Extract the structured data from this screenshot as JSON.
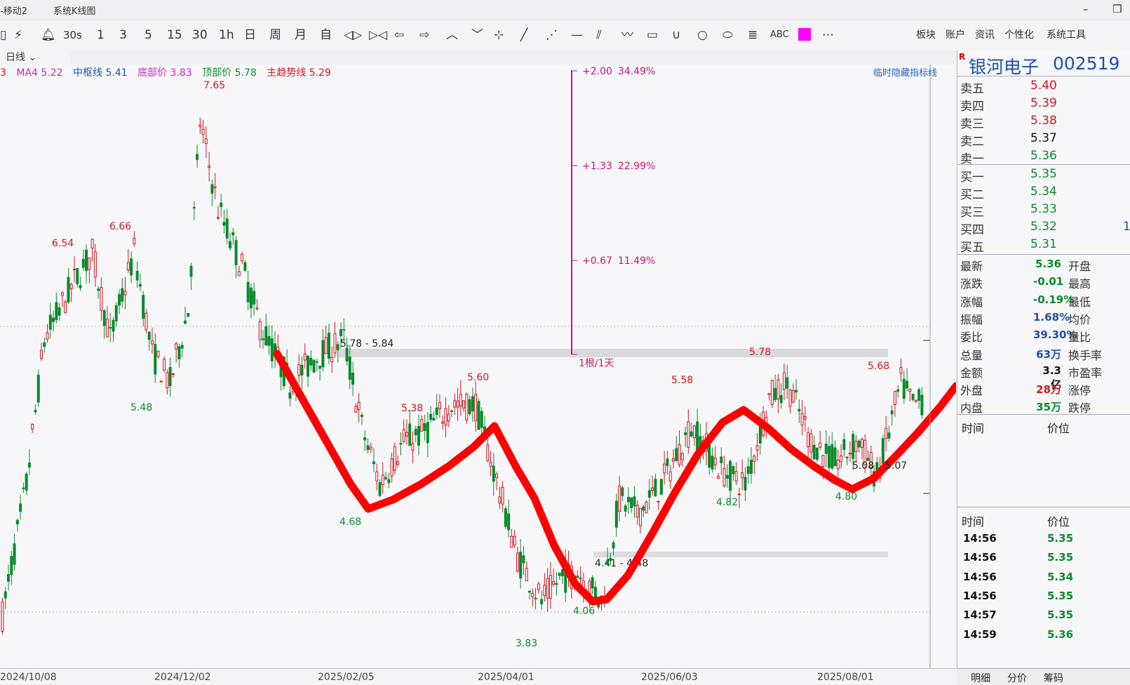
{
  "titlebar": {
    "app": "-移动2",
    "window": "系统K线图"
  },
  "toolbar": {
    "periods": [
      "30s",
      "1",
      "3",
      "5",
      "15",
      "30",
      "1h",
      "日",
      "周",
      "月",
      "自"
    ],
    "draw_tools": [
      "ABC"
    ],
    "menus": [
      "板块",
      "账户",
      "资讯",
      "个性化",
      "系统工具"
    ]
  },
  "period_select": "日线",
  "indicators": [
    {
      "text": "3",
      "color": "#d4141c"
    },
    {
      "text": "MA4 5.22",
      "color": "#cc22cc"
    },
    {
      "text": "中枢线 5.41",
      "color": "#1f4fa8"
    },
    {
      "text": "底部价 3.83",
      "color": "#cc22cc"
    },
    {
      "text": "顶部价 5.78",
      "color": "#0a8a2a"
    },
    {
      "text": "主趋势线 5.29",
      "color": "#d4141c"
    }
  ],
  "hide_tip": "临时隐藏指标线",
  "measure": {
    "levels": [
      {
        "abs": "+2.00",
        "pct": "34.49%"
      },
      {
        "abs": "+1.33",
        "pct": "22.99%"
      },
      {
        "abs": "+0.67",
        "pct": "11.49%"
      }
    ],
    "note": "1根/1天"
  },
  "zones": [
    {
      "label": "5.78 - 5.84"
    },
    {
      "label": "4.41 - 4.48"
    }
  ],
  "peak_labels": {
    "p765": "7.65",
    "p654": "6.54",
    "p666": "6.66",
    "p548": "5.48",
    "p468": "4.68",
    "p538": "5.38",
    "p560": "5.60",
    "p383": "3.83",
    "p406": "4.06",
    "p558": "5.58",
    "p482": "4.82",
    "p578": "5.78",
    "p568": "5.68",
    "p480": "4.80",
    "p508": "5.08",
    "p507": "5.07"
  },
  "dates": [
    "2024/10/08",
    "2024/12/02",
    "2025/02/05",
    "2025/04/01",
    "2025/06/03",
    "2025/08/01"
  ],
  "stock": {
    "name": "银河电子",
    "code": "002519",
    "badge": "R"
  },
  "orderbook": {
    "asks": [
      {
        "label": "卖五",
        "price": "5.40"
      },
      {
        "label": "卖四",
        "price": "5.39"
      },
      {
        "label": "卖三",
        "price": "5.38"
      },
      {
        "label": "卖二",
        "price": "5.37"
      },
      {
        "label": "卖一",
        "price": "5.36"
      }
    ],
    "bids": [
      {
        "label": "买一",
        "price": "5.35"
      },
      {
        "label": "买二",
        "price": "5.34"
      },
      {
        "label": "买三",
        "price": "5.33"
      },
      {
        "label": "买四",
        "price": "5.32",
        "extra": "1"
      },
      {
        "label": "买五",
        "price": "5.31"
      }
    ]
  },
  "quote": [
    {
      "label": "最新",
      "value": "5.36",
      "label2": "开盘"
    },
    {
      "label": "涨跌",
      "value": "-0.01",
      "label2": "最高"
    },
    {
      "label": "涨幅",
      "value": "-0.19%",
      "label2": "最低"
    },
    {
      "label": "振幅",
      "value": "1.68%",
      "label2": "均价"
    },
    {
      "label": "委比",
      "value": "39.30%",
      "label2": "量比"
    },
    {
      "label": "总量",
      "value": "63万",
      "label2": "换手率"
    },
    {
      "label": "金额",
      "value": "3.3亿",
      "label2": "市盈率"
    },
    {
      "label": "外盘",
      "value": "28万",
      "label2": "涨停"
    },
    {
      "label": "内盘",
      "value": "35万",
      "label2": "跌停"
    }
  ],
  "ticks_header": {
    "time": "时间",
    "price": "价位"
  },
  "ticks": [
    {
      "time": "14:56",
      "price": "5.35"
    },
    {
      "time": "14:56",
      "price": "5.35"
    },
    {
      "time": "14:56",
      "price": "5.34"
    },
    {
      "time": "14:56",
      "price": "5.35"
    },
    {
      "time": "14:57",
      "price": "5.35"
    },
    {
      "time": "14:59",
      "price": "5.36"
    }
  ],
  "tabs": [
    "明细",
    "分价",
    "筹码"
  ],
  "colors": {
    "up": "#d4141c",
    "down": "#0a8a2a",
    "trend": "#ff0000",
    "measure": "#cc1177"
  }
}
